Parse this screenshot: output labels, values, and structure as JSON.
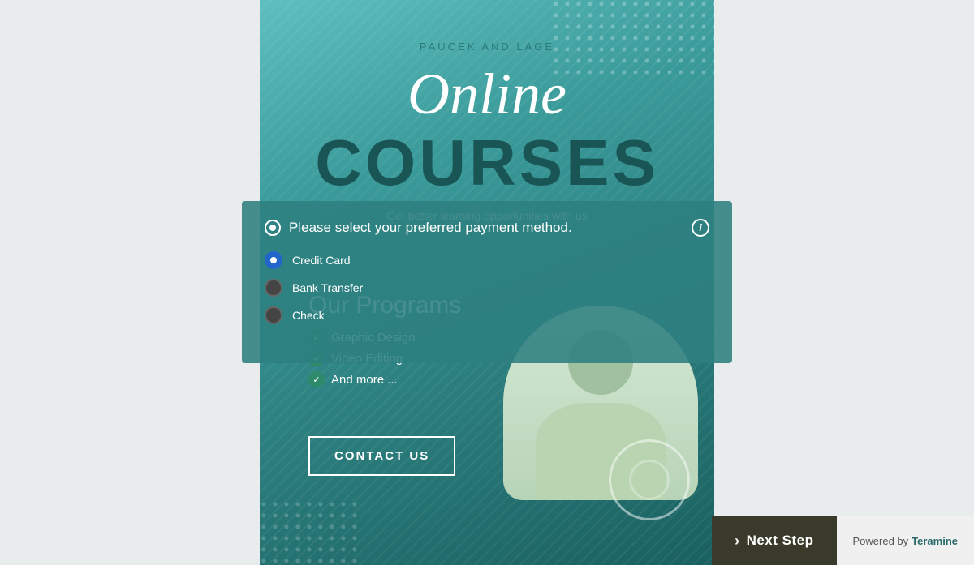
{
  "company": {
    "name": "PAUCEK AND LAGE"
  },
  "hero": {
    "online_label": "Online",
    "courses_label": "COURSES",
    "subtitle": "Get better learning opportunities with us"
  },
  "programs": {
    "title": "Our Programs",
    "items": [
      {
        "label": "Graphic Design"
      },
      {
        "label": "Video Editing"
      },
      {
        "label": "And more ..."
      }
    ]
  },
  "contact": {
    "button_label": "CONTACT US"
  },
  "modal": {
    "title": "Please select your preferred payment method.",
    "options": [
      {
        "label": "Credit Card",
        "selected": true
      },
      {
        "label": "Bank Transfer",
        "selected": false
      },
      {
        "label": "Check",
        "selected": false
      }
    ]
  },
  "footer": {
    "next_step_label": "Next Step",
    "powered_by_label": "Powered by",
    "brand_label": "Teramine"
  },
  "colors": {
    "teal_dark": "#1a6060",
    "teal_mid": "#2d8080",
    "teal_light": "#5fbfbf",
    "dark_olive": "#3a3a2a",
    "white": "#ffffff"
  }
}
